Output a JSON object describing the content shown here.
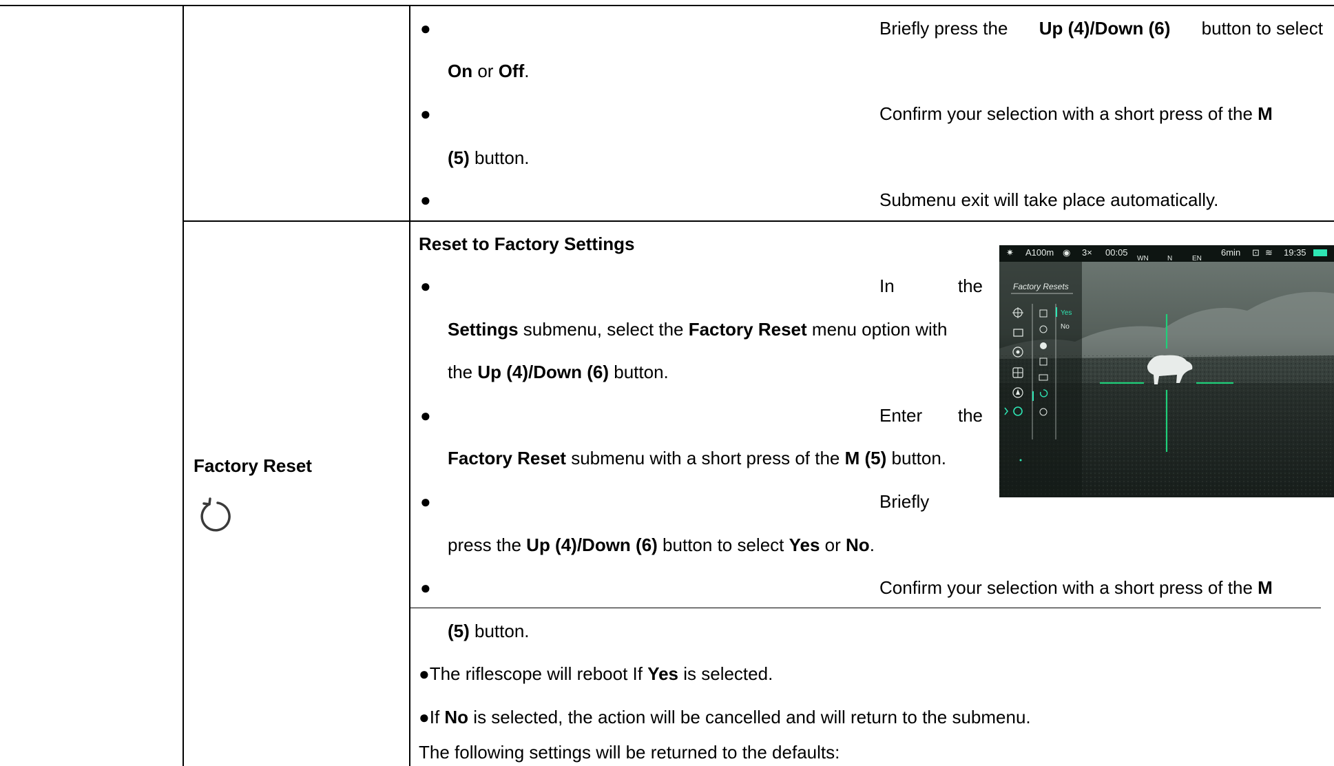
{
  "row1": {
    "bullets": [
      {
        "p1": "Briefly press the ",
        "b1": "Up (4)/Down (6)",
        "p2": " button to select",
        "c1": "On",
        "c2": " or ",
        "c3": "Off",
        "c4": "."
      },
      {
        "p1": "Confirm your selection with a short press of the ",
        "b1": "M",
        "c1": "(5)",
        "c2": " button."
      },
      {
        "p1": "Submenu exit will take place automatically."
      }
    ]
  },
  "row2": {
    "title": "Factory Reset",
    "heading": "Reset to Factory Settings",
    "b1": {
      "w1": "In",
      "w2": "the",
      "c1": "Settings",
      "c2": " submenu, select the ",
      "c3": "Factory Reset",
      "c4": " menu option with",
      "c5": "the ",
      "c6": "Up (4)/Down (6)",
      "c7": " button."
    },
    "b2": {
      "w1": "Enter",
      "w2": "the",
      "c1": "Factory Reset",
      "c2": " submenu with a short press of the ",
      "c3": "M (5)",
      "c4": " button."
    },
    "b3": {
      "w1": "Briefly",
      "c1": "press the ",
      "c2": "Up (4)/Down (6)",
      "c3": " button to select ",
      "c4": "Yes",
      "c5": " or ",
      "c6": "No",
      "c7": "."
    },
    "b4": {
      "p1": "Confirm your selection with a short press of the ",
      "b1": "M",
      "c1": "(5)",
      "c2": " button."
    },
    "l1": {
      "a": "The riflescope will reboot If ",
      "b": "Yes",
      "c": " is selected."
    },
    "l2": {
      "a": "If ",
      "b": "No",
      "c": " is selected, the action will be cancelled and will return to the submenu."
    },
    "l3": "The following settings will be returned to the defaults:"
  },
  "scope": {
    "status": {
      "mode": "A100m",
      "zoom": "3×",
      "rec": "00:05",
      "compass": [
        "WN",
        "N",
        "EN"
      ],
      "battery_time": "6min",
      "clock": "19:35"
    },
    "menu_title": "Factory Resets",
    "options": [
      "Yes",
      "No"
    ],
    "accent": "#2ee6b4"
  }
}
